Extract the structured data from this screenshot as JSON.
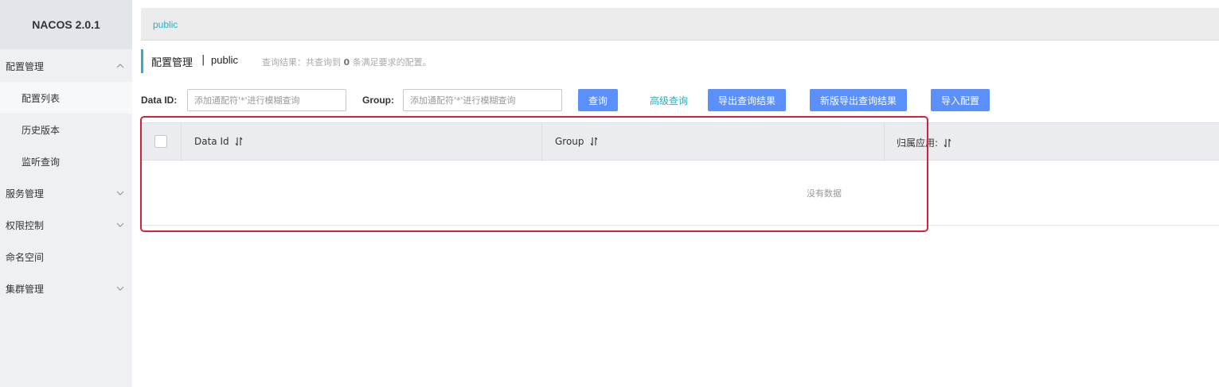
{
  "app": {
    "brand": "NACOS 2.0.1"
  },
  "sidebar": {
    "items": [
      {
        "label": "配置管理",
        "expanded": true
      },
      {
        "label": "配置列表",
        "sub": true,
        "active": true
      },
      {
        "label": "历史版本",
        "sub": true
      },
      {
        "label": "监听查询",
        "sub": true
      },
      {
        "label": "服务管理",
        "expanded": false
      },
      {
        "label": "权限控制",
        "expanded": false
      },
      {
        "label": "命名空间"
      },
      {
        "label": "集群管理",
        "expanded": false
      }
    ]
  },
  "topbar": {
    "namespace": "public"
  },
  "page": {
    "title": "配置管理",
    "separator": "|",
    "namespace": "public",
    "result_prefix": "查询结果：共查询到",
    "result_count": "0",
    "result_suffix": "条满足要求的配置。"
  },
  "search": {
    "dataid_label": "Data ID:",
    "dataid_placeholder": "添加通配符'*'进行模糊查询",
    "group_label": "Group:",
    "group_placeholder": "添加通配符'*'进行模糊查询",
    "query_button": "查询",
    "advanced_query": "高级查询",
    "export_button": "导出查询结果",
    "export_new_button": "新版导出查询结果",
    "import_button": "导入配置"
  },
  "table": {
    "columns": [
      "Data Id",
      "Group",
      "归属应用:"
    ],
    "empty_text": "没有数据"
  },
  "colors": {
    "accent": "#25b0c6",
    "button": "#5b8ff9",
    "highlight": "#d7213a"
  }
}
